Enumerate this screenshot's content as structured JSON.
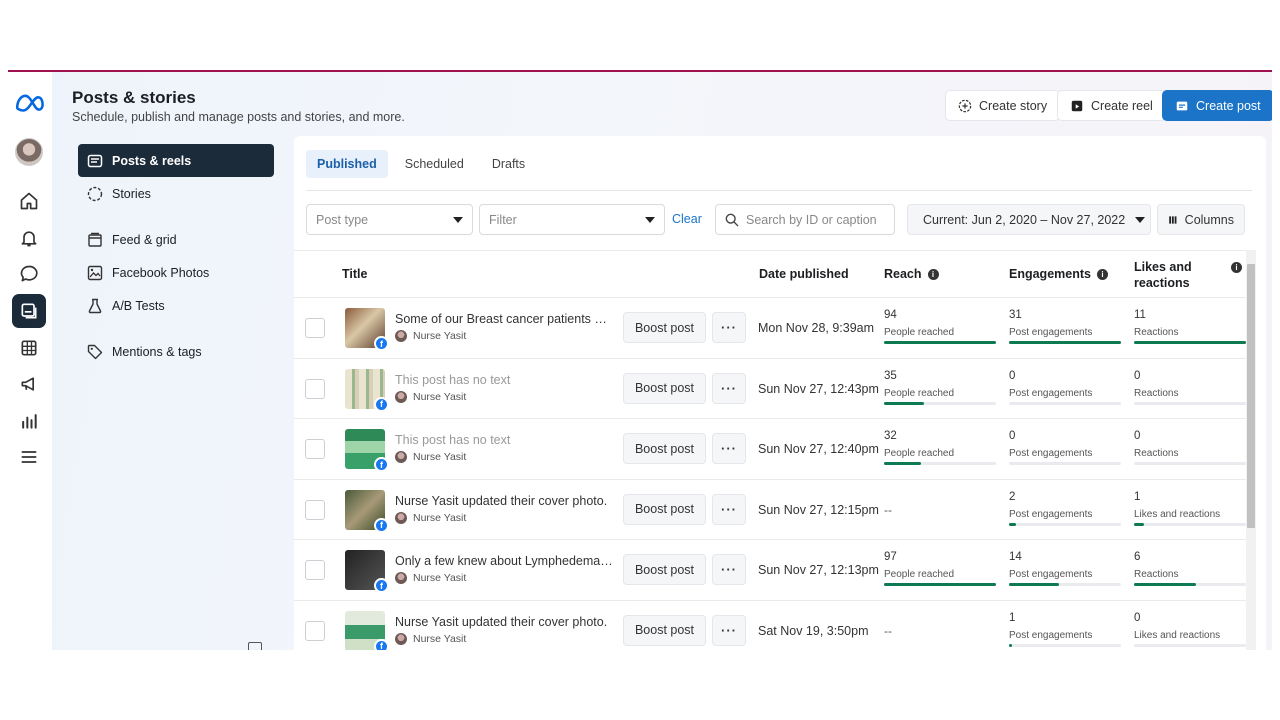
{
  "header": {
    "title": "Posts & stories",
    "subtitle": "Schedule, publish and manage posts and stories, and more.",
    "buttons": {
      "create_story": "Create story",
      "create_reel": "Create reel",
      "create_post": "Create post"
    }
  },
  "secondary_nav": {
    "items": [
      {
        "label": "Posts & reels"
      },
      {
        "label": "Stories"
      },
      {
        "label": "Feed & grid"
      },
      {
        "label": "Facebook Photos"
      },
      {
        "label": "A/B Tests"
      },
      {
        "label": "Mentions & tags"
      }
    ]
  },
  "tabs": {
    "published": "Published",
    "scheduled": "Scheduled",
    "drafts": "Drafts"
  },
  "filters": {
    "post_type_placeholder": "Post type",
    "filter_placeholder": "Filter",
    "clear": "Clear",
    "search_placeholder": "Search by ID or caption",
    "date_range": "Current: Jun 2, 2020 – Nov 27, 2022",
    "columns": "Columns"
  },
  "table": {
    "headers": {
      "title": "Title",
      "date_published": "Date published",
      "reach": "Reach",
      "engagements": "Engagements",
      "likes": "Likes and reactions"
    },
    "boost_label": "Boost post",
    "more_label": "···",
    "rows": [
      {
        "title": "Some of our Breast cancer patients who ...",
        "muted": false,
        "author": "Nurse Yasit",
        "date": "Mon Nov 28, 9:39am",
        "reach": {
          "value": "94",
          "label": "People reached",
          "fill": 1.0
        },
        "engagements": {
          "value": "31",
          "label": "Post engagements",
          "fill": 1.0
        },
        "likes": {
          "value": "11",
          "label": "Reactions",
          "fill": 1.0
        },
        "thumb": "linear-gradient(135deg,#8a5a3a,#d9c7a6 45%,#5a3b2b)"
      },
      {
        "title": "This post has no text",
        "muted": true,
        "author": "Nurse Yasit",
        "date": "Sun Nov 27, 12:43pm",
        "reach": {
          "value": "35",
          "label": "People reached",
          "fill": 0.36
        },
        "engagements": {
          "value": "0",
          "label": "Post engagements",
          "fill": 0
        },
        "likes": {
          "value": "0",
          "label": "Reactions",
          "fill": 0
        },
        "thumb": "repeating-linear-gradient(90deg,#e9e4d0 0 7px,#9bb78f 7px 10px,#d9cfb6 10px 14px)"
      },
      {
        "title": "This post has no text",
        "muted": true,
        "author": "Nurse Yasit",
        "date": "Sun Nov 27, 12:40pm",
        "reach": {
          "value": "32",
          "label": "People reached",
          "fill": 0.33
        },
        "engagements": {
          "value": "0",
          "label": "Post engagements",
          "fill": 0
        },
        "likes": {
          "value": "0",
          "label": "Reactions",
          "fill": 0
        },
        "thumb": "linear-gradient(180deg,#2e8b57 0 30%,#9fd3a8 30% 60%,#3aa06a 60%)"
      },
      {
        "title": "Nurse Yasit updated their cover photo.",
        "muted": false,
        "author": "Nurse Yasit",
        "date": "Sun Nov 27, 12:15pm",
        "reach": {
          "value": "--",
          "label": "",
          "fill": null
        },
        "engagements": {
          "value": "2",
          "label": "Post engagements",
          "fill": 0.06
        },
        "likes": {
          "value": "1",
          "label": "Likes and reactions",
          "fill": 0.09
        },
        "thumb": "linear-gradient(135deg,#4a5a3a,#a89a78 50%,#3a4a2a)"
      },
      {
        "title": "Only a few knew about Lymphedema esp...",
        "muted": false,
        "author": "Nurse Yasit",
        "date": "Sun Nov 27, 12:13pm",
        "reach": {
          "value": "97",
          "label": "People reached",
          "fill": 1.0
        },
        "engagements": {
          "value": "14",
          "label": "Post engagements",
          "fill": 0.45
        },
        "likes": {
          "value": "6",
          "label": "Reactions",
          "fill": 0.55
        },
        "thumb": "linear-gradient(135deg,#222,#555)"
      },
      {
        "title": "Nurse Yasit updated their cover photo.",
        "muted": false,
        "author": "Nurse Yasit",
        "date": "Sat Nov 19, 3:50pm",
        "reach": {
          "value": "--",
          "label": "",
          "fill": null
        },
        "engagements": {
          "value": "1",
          "label": "Post engagements",
          "fill": 0.03
        },
        "likes": {
          "value": "0",
          "label": "Likes and reactions",
          "fill": 0
        },
        "thumb": "linear-gradient(180deg,#e2eadd 0 35%,#3a9a6a 35% 70%,#cfe0c6 70%)"
      }
    ]
  }
}
